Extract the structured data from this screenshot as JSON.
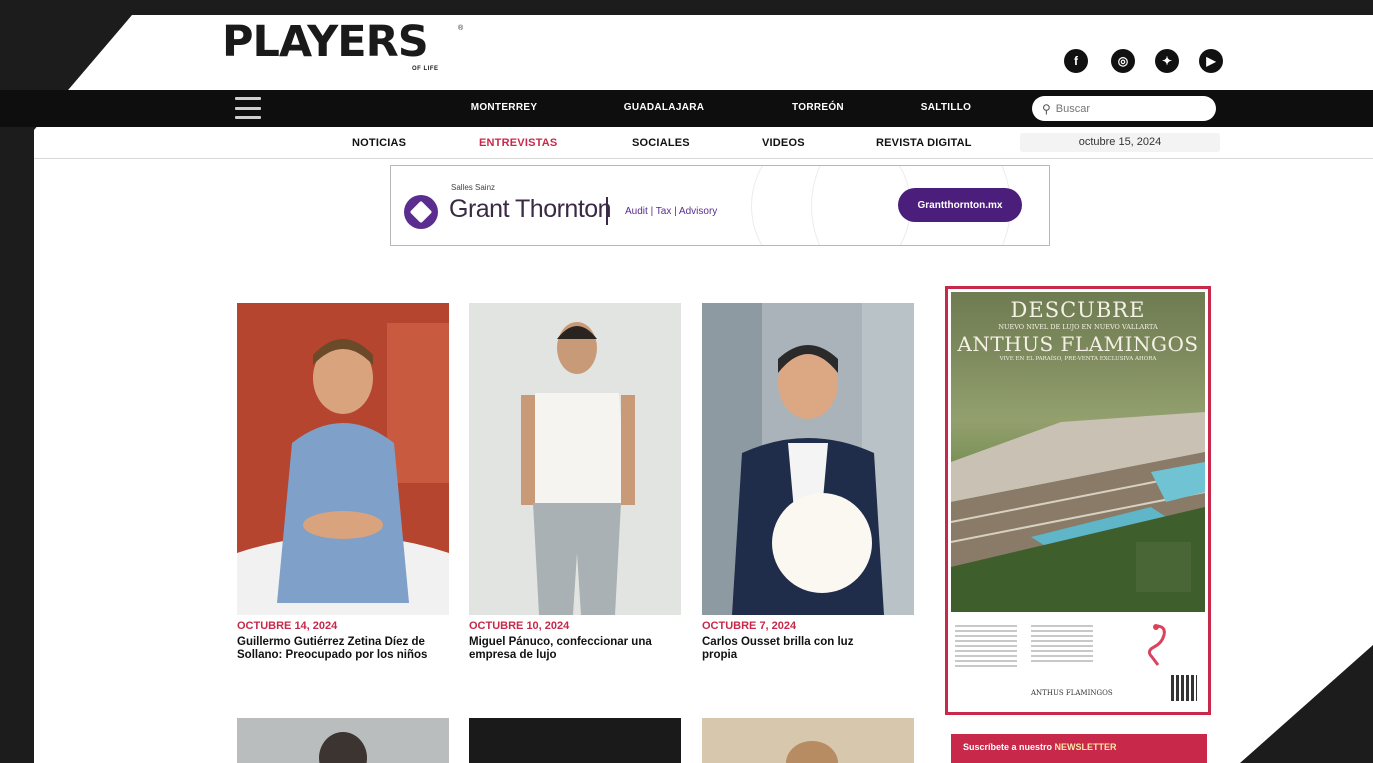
{
  "header": {
    "logo": "PLAYERS",
    "logo_reg": "®",
    "logo_sub": "OF LIFE",
    "social": [
      {
        "icon": "facebook-icon",
        "glyph": "f"
      },
      {
        "icon": "instagram-icon",
        "glyph": "◎"
      },
      {
        "icon": "twitter-icon",
        "glyph": "✦"
      },
      {
        "icon": "youtube-icon",
        "glyph": "▶"
      }
    ]
  },
  "nav": {
    "cities": [
      "MONTERREY",
      "GUADALAJARA",
      "TORREÓN",
      "SALTILLO"
    ],
    "search_placeholder": "Buscar"
  },
  "subnav": {
    "items": [
      "NOTICIAS",
      "ENTREVISTAS",
      "SOCIALES",
      "VIDEOS",
      "REVISTA DIGITAL"
    ],
    "active": "ENTREVISTAS",
    "date": "octubre 15, 2024"
  },
  "banner": {
    "small": "Salles Sainz",
    "brand": "Grant Thornton",
    "tagline": "Audit | Tax | Advisory",
    "button": "Grantthornton.mx"
  },
  "articles": [
    {
      "date": "OCTUBRE 14, 2024",
      "title": "Guillermo Gutiérrez Zetina Díez de Sollano: Preocupado por los niños"
    },
    {
      "date": "OCTUBRE 10, 2024",
      "title": "Miguel Pánuco, confeccionar una empresa de lujo"
    },
    {
      "date": "OCTUBRE 7, 2024",
      "title": "Carlos Ousset brilla con luz propia"
    }
  ],
  "side_ad": {
    "title": "DESCUBRE",
    "line1": "NUEVO NIVEL DE LUJO EN NUEVO VALLARTA",
    "brand": "ANTHUS FLAMINGOS",
    "line2": "VIVE EN EL PARAÍSO, PRE-VENTA EXCLUSIVA AHORA",
    "footer_brand": "ANTHUS FLAMINGOS"
  },
  "newsletter": {
    "prefix": "Suscríbete a nuestro",
    "highlight": "NEWSLETTER"
  },
  "colors": {
    "accent": "#c8284a",
    "nav_bg": "#0e0e0e",
    "banner_purple": "#4a1e7a"
  }
}
